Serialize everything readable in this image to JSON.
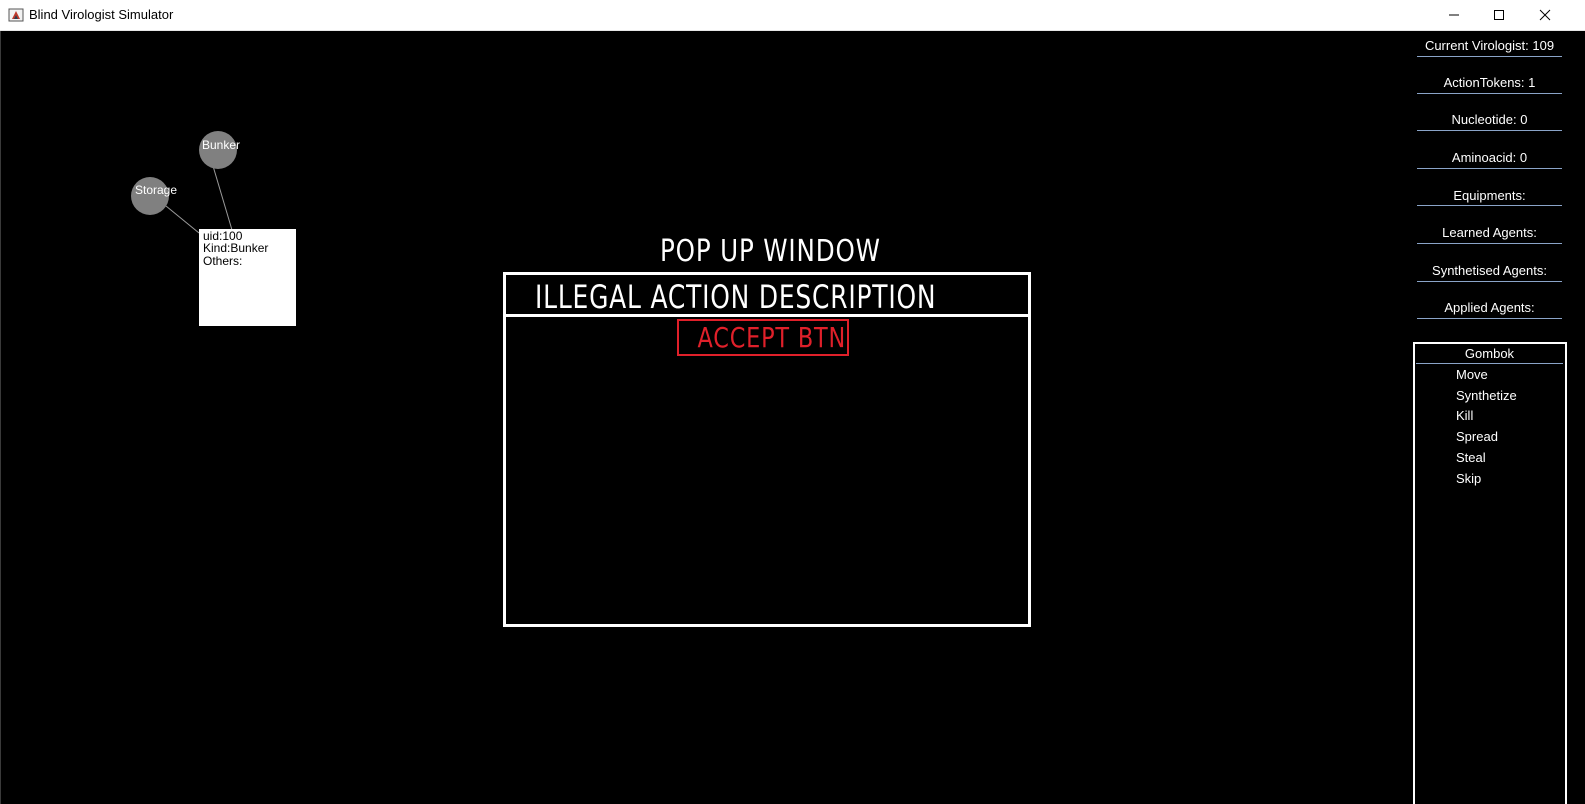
{
  "window": {
    "title": "Blind Virologist Simulator",
    "minimize_icon": "minimize-icon",
    "maximize_icon": "maximize-icon",
    "close_icon": "close-icon"
  },
  "map": {
    "nodes": [
      {
        "label": "Bunker",
        "color": "#808080"
      },
      {
        "label": "Storage",
        "color": "#808080"
      }
    ],
    "info_box": {
      "uid": "uid:100",
      "kind": "Kind:Bunker",
      "others": "Others:"
    }
  },
  "popup": {
    "title": "POP UP WINDOW",
    "description": "ILLEGAL ACTION DESCRIPTION",
    "accept_button": "ACCEPT BTN",
    "accent_color": "#e0202a"
  },
  "stats": {
    "current_virologist": "Current Virologist:  109",
    "action_tokens": "ActionTokens:  1",
    "nucleotide": "Nucleotide:  0",
    "aminoacid": "Aminoacid:  0",
    "equipments": "Equipments:",
    "learned_agents": "Learned Agents:",
    "synthetised_agents": "Synthetised Agents:",
    "applied_agents": "Applied Agents:"
  },
  "actions": {
    "header": "Gombok",
    "items": [
      "Move",
      "Synthetize",
      "Kill",
      "Spread",
      "Steal",
      "Skip"
    ]
  }
}
